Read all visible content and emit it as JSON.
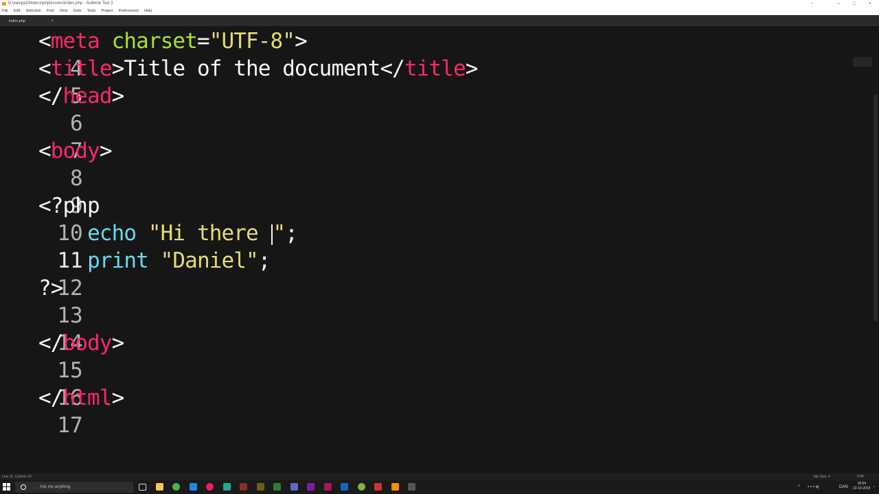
{
  "window": {
    "title": "D:\\xampp2\\htdocs\\phplessons\\index.php - Sublime Text 2",
    "controls": [
      "–",
      "□",
      "×"
    ]
  },
  "menu": [
    "File",
    "Edit",
    "Selection",
    "Find",
    "View",
    "Goto",
    "Tools",
    "Project",
    "Preferences",
    "Help"
  ],
  "tab": {
    "label": "index.php",
    "close": "×"
  },
  "editor": {
    "line_numbers": [
      "4",
      "5",
      "6",
      "7",
      "8",
      "9",
      "10",
      "11",
      "12",
      "13",
      "14",
      "15",
      "16",
      "17"
    ],
    "active_line": "11",
    "lines": {
      "l4": [
        "<",
        "meta",
        " ",
        "charset",
        "=",
        "\"UTF-8\"",
        ">"
      ],
      "l5": [
        "<",
        "title",
        ">",
        "Title of the document",
        "</",
        "title",
        ">"
      ],
      "l6": [
        "</",
        "head",
        ">"
      ],
      "l8": [
        "<",
        "body",
        ">"
      ],
      "l10": [
        "<?php"
      ],
      "l11": [
        "    ",
        "echo",
        " ",
        "\"Hi there ",
        "\"",
        ";"
      ],
      "l12": [
        "    ",
        "print",
        " ",
        "\"Daniel\"",
        ";"
      ],
      "l13": [
        "?>"
      ],
      "l15": [
        "</",
        "body",
        ">"
      ],
      "l17": [
        "</",
        "html",
        ">"
      ]
    }
  },
  "colors": {
    "background": "#161616",
    "tag": "#f92672",
    "attribute": "#a6e22e",
    "string": "#e6db74",
    "keyword": "#66d9ef",
    "text": "#f8f8f2"
  },
  "status": {
    "position": "Line 11, Column 20",
    "tab_size": "Tab Size: 4",
    "syntax": "PHP"
  },
  "taskbar": {
    "search_placeholder": "Ask me anything",
    "language": "DAN",
    "time": "18:54",
    "date": "22-10-2015"
  }
}
